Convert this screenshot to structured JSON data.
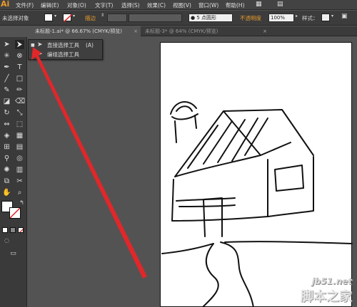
{
  "app": {
    "logo": "Ai"
  },
  "menubar": {
    "items": [
      "文件(F)",
      "编辑(E)",
      "对象(O)",
      "文字(T)",
      "选择(S)",
      "效果(C)",
      "视图(V)",
      "窗口(W)",
      "帮助(H)"
    ]
  },
  "control_bar": {
    "selection_status": "未选择对象",
    "stroke_label": "描边",
    "stroke_value": "",
    "brush_label": "5 点圆形",
    "opacity_label": "不透明度",
    "opacity_value": "100%",
    "style_label": "样式："
  },
  "tabs": [
    {
      "label": "未标题-1.ai* @ 66.67% (CMYK/预览)",
      "close": "×",
      "active": true
    },
    {
      "label": "未标题-3* @ 64% (CMYK/预览)",
      "close": "×",
      "active": false
    }
  ],
  "flyout": {
    "items": [
      {
        "bullet": "■",
        "icon": "arrow-icon",
        "label": "直接选择工具",
        "shortcut": "(A)"
      },
      {
        "bullet": "",
        "icon": "arrow-plus-icon",
        "label": "编组选择工具",
        "shortcut": ""
      }
    ]
  },
  "watermark": {
    "url": "jb51.net",
    "name": "脚本之家"
  },
  "colors": {
    "accent": "#e89b2c",
    "arrow": "#e0272a",
    "panel": "#3a3a3a",
    "canvas": "#535353"
  }
}
